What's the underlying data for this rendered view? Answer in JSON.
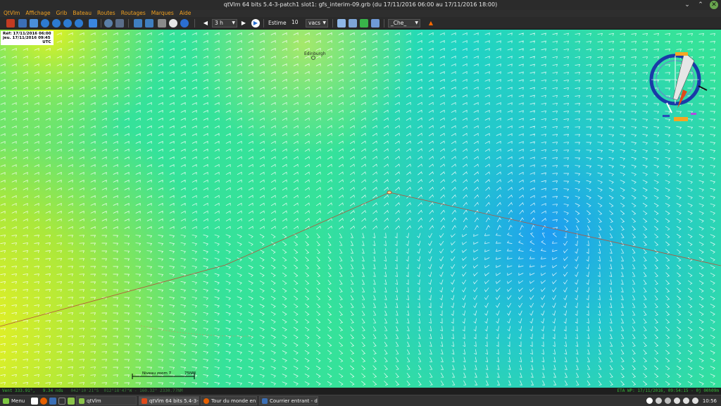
{
  "window": {
    "title": "qtVlm 64 bits 5.4-3-patch1 slot1: gfs_interim-09.grb (du 17/11/2016 06:00 au 17/11/2016 18:00)",
    "controls": [
      "⌄",
      "⌃",
      "✕"
    ]
  },
  "menu": [
    "QtVlm",
    "Affichage",
    "Grib",
    "Bateau",
    "Routes",
    "Routages",
    "Marques",
    "Aide"
  ],
  "toolbar": {
    "step_value": "3 h",
    "mode_label": "Estime",
    "estime_value": "10",
    "estime_unit": "vacs",
    "boat_select": "_Che_"
  },
  "map": {
    "ref_line1": "Réf: 17/11/2016 06:00",
    "ref_line2": "jeu. 17/11/2016 09:45",
    "ref_tz": "UTC",
    "city_label": "Edinburgh",
    "scale_left": "Niveau zoom 7",
    "scale_right": "75NM"
  },
  "status": {
    "wind": "Vent 333.91°,   9.34 nds",
    "position": "042°10'21\"S  012°18'47\"W - 160.32° 2330.77NM",
    "eta": "ETA WP: 17/11/2016, 09:54:15 - 0j 00h09m"
  },
  "taskbar": {
    "menu_label": "Menu",
    "tasks": [
      {
        "label": "qtVlm",
        "icon": "folder-icon"
      },
      {
        "label": "qtVlm 64 bits 5.4-3-p...",
        "icon": "qtvlm-icon"
      },
      {
        "label": "Tour du monde en S...",
        "icon": "firefox-icon"
      },
      {
        "label": "Courrier entrant - de...",
        "icon": "thunderbird-icon"
      }
    ],
    "clock": "10:56"
  },
  "colors": {
    "menu_text": "#f0a020",
    "status_text": "#37b437",
    "route_line": "#b5533b",
    "wind_arrow": "#ffffff"
  }
}
